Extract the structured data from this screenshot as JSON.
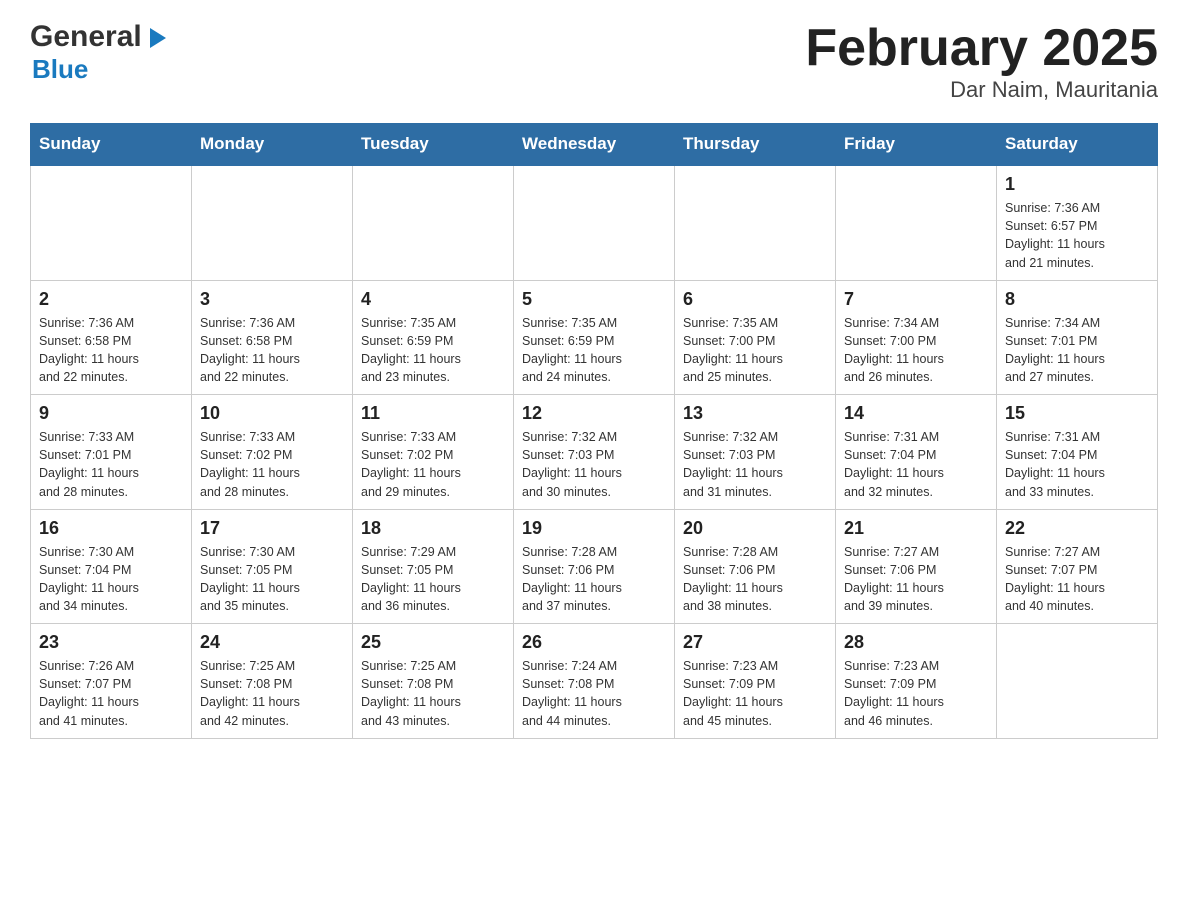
{
  "header": {
    "logo_general": "General",
    "logo_blue": "Blue",
    "title": "February 2025",
    "subtitle": "Dar Naim, Mauritania"
  },
  "days_of_week": [
    "Sunday",
    "Monday",
    "Tuesday",
    "Wednesday",
    "Thursday",
    "Friday",
    "Saturday"
  ],
  "weeks": [
    [
      {
        "day": "",
        "info": ""
      },
      {
        "day": "",
        "info": ""
      },
      {
        "day": "",
        "info": ""
      },
      {
        "day": "",
        "info": ""
      },
      {
        "day": "",
        "info": ""
      },
      {
        "day": "",
        "info": ""
      },
      {
        "day": "1",
        "info": "Sunrise: 7:36 AM\nSunset: 6:57 PM\nDaylight: 11 hours\nand 21 minutes."
      }
    ],
    [
      {
        "day": "2",
        "info": "Sunrise: 7:36 AM\nSunset: 6:58 PM\nDaylight: 11 hours\nand 22 minutes."
      },
      {
        "day": "3",
        "info": "Sunrise: 7:36 AM\nSunset: 6:58 PM\nDaylight: 11 hours\nand 22 minutes."
      },
      {
        "day": "4",
        "info": "Sunrise: 7:35 AM\nSunset: 6:59 PM\nDaylight: 11 hours\nand 23 minutes."
      },
      {
        "day": "5",
        "info": "Sunrise: 7:35 AM\nSunset: 6:59 PM\nDaylight: 11 hours\nand 24 minutes."
      },
      {
        "day": "6",
        "info": "Sunrise: 7:35 AM\nSunset: 7:00 PM\nDaylight: 11 hours\nand 25 minutes."
      },
      {
        "day": "7",
        "info": "Sunrise: 7:34 AM\nSunset: 7:00 PM\nDaylight: 11 hours\nand 26 minutes."
      },
      {
        "day": "8",
        "info": "Sunrise: 7:34 AM\nSunset: 7:01 PM\nDaylight: 11 hours\nand 27 minutes."
      }
    ],
    [
      {
        "day": "9",
        "info": "Sunrise: 7:33 AM\nSunset: 7:01 PM\nDaylight: 11 hours\nand 28 minutes."
      },
      {
        "day": "10",
        "info": "Sunrise: 7:33 AM\nSunset: 7:02 PM\nDaylight: 11 hours\nand 28 minutes."
      },
      {
        "day": "11",
        "info": "Sunrise: 7:33 AM\nSunset: 7:02 PM\nDaylight: 11 hours\nand 29 minutes."
      },
      {
        "day": "12",
        "info": "Sunrise: 7:32 AM\nSunset: 7:03 PM\nDaylight: 11 hours\nand 30 minutes."
      },
      {
        "day": "13",
        "info": "Sunrise: 7:32 AM\nSunset: 7:03 PM\nDaylight: 11 hours\nand 31 minutes."
      },
      {
        "day": "14",
        "info": "Sunrise: 7:31 AM\nSunset: 7:04 PM\nDaylight: 11 hours\nand 32 minutes."
      },
      {
        "day": "15",
        "info": "Sunrise: 7:31 AM\nSunset: 7:04 PM\nDaylight: 11 hours\nand 33 minutes."
      }
    ],
    [
      {
        "day": "16",
        "info": "Sunrise: 7:30 AM\nSunset: 7:04 PM\nDaylight: 11 hours\nand 34 minutes."
      },
      {
        "day": "17",
        "info": "Sunrise: 7:30 AM\nSunset: 7:05 PM\nDaylight: 11 hours\nand 35 minutes."
      },
      {
        "day": "18",
        "info": "Sunrise: 7:29 AM\nSunset: 7:05 PM\nDaylight: 11 hours\nand 36 minutes."
      },
      {
        "day": "19",
        "info": "Sunrise: 7:28 AM\nSunset: 7:06 PM\nDaylight: 11 hours\nand 37 minutes."
      },
      {
        "day": "20",
        "info": "Sunrise: 7:28 AM\nSunset: 7:06 PM\nDaylight: 11 hours\nand 38 minutes."
      },
      {
        "day": "21",
        "info": "Sunrise: 7:27 AM\nSunset: 7:06 PM\nDaylight: 11 hours\nand 39 minutes."
      },
      {
        "day": "22",
        "info": "Sunrise: 7:27 AM\nSunset: 7:07 PM\nDaylight: 11 hours\nand 40 minutes."
      }
    ],
    [
      {
        "day": "23",
        "info": "Sunrise: 7:26 AM\nSunset: 7:07 PM\nDaylight: 11 hours\nand 41 minutes."
      },
      {
        "day": "24",
        "info": "Sunrise: 7:25 AM\nSunset: 7:08 PM\nDaylight: 11 hours\nand 42 minutes."
      },
      {
        "day": "25",
        "info": "Sunrise: 7:25 AM\nSunset: 7:08 PM\nDaylight: 11 hours\nand 43 minutes."
      },
      {
        "day": "26",
        "info": "Sunrise: 7:24 AM\nSunset: 7:08 PM\nDaylight: 11 hours\nand 44 minutes."
      },
      {
        "day": "27",
        "info": "Sunrise: 7:23 AM\nSunset: 7:09 PM\nDaylight: 11 hours\nand 45 minutes."
      },
      {
        "day": "28",
        "info": "Sunrise: 7:23 AM\nSunset: 7:09 PM\nDaylight: 11 hours\nand 46 minutes."
      },
      {
        "day": "",
        "info": ""
      }
    ]
  ]
}
